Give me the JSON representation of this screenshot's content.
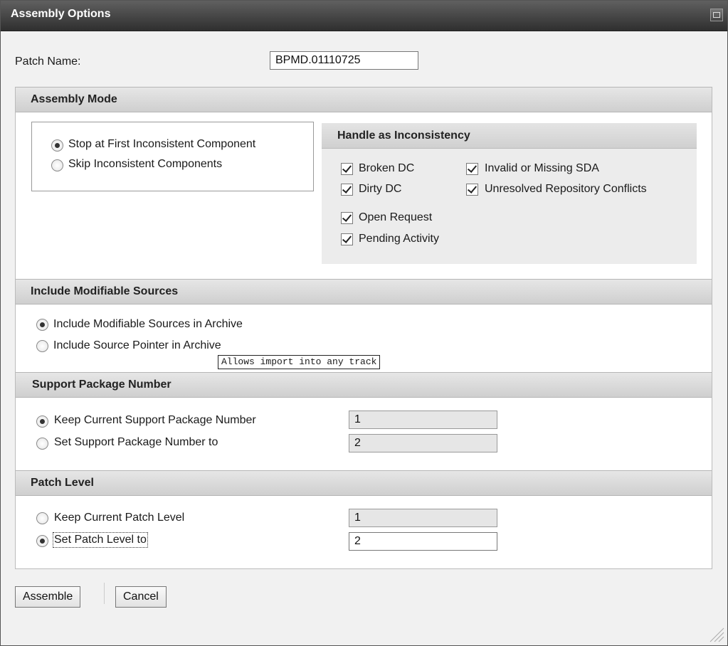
{
  "window": {
    "title": "Assembly Options",
    "icon": "window-restore-icon"
  },
  "patch_name": {
    "label": "Patch Name:",
    "value": "BPMD.01110725"
  },
  "assembly_mode": {
    "header": "Assembly Mode",
    "options": [
      {
        "label": "Stop at First Inconsistent Component",
        "selected": true
      },
      {
        "label": "Skip Inconsistent Components",
        "selected": false
      }
    ],
    "inconsistency": {
      "header": "Handle as Inconsistency",
      "checks": [
        {
          "label": "Broken DC",
          "checked": true
        },
        {
          "label": "Invalid or Missing SDA",
          "checked": true
        },
        {
          "label": "Dirty DC",
          "checked": true
        },
        {
          "label": "Unresolved Repository Conflicts",
          "checked": true
        },
        {
          "label": "Open Request",
          "checked": true
        },
        {
          "label": "Pending Activity",
          "checked": true
        }
      ]
    }
  },
  "modifiable_sources": {
    "header": "Include Modifiable Sources",
    "options": [
      {
        "label": "Include Modifiable Sources in Archive",
        "selected": true
      },
      {
        "label": "Include Source Pointer in Archive",
        "selected": false
      }
    ],
    "tooltip": "Allows import into any track"
  },
  "support_package": {
    "header": "Support Package Number",
    "options": [
      {
        "label": "Keep Current Support Package Number",
        "selected": true,
        "value": "1"
      },
      {
        "label": "Set Support Package Number to",
        "selected": false,
        "value": "2"
      }
    ]
  },
  "patch_level": {
    "header": "Patch Level",
    "options": [
      {
        "label": "Keep Current Patch Level",
        "selected": false,
        "value": "1"
      },
      {
        "label": "Set Patch Level to",
        "selected": true,
        "value": "2"
      }
    ]
  },
  "buttons": {
    "assemble": "Assemble",
    "cancel": "Cancel"
  }
}
